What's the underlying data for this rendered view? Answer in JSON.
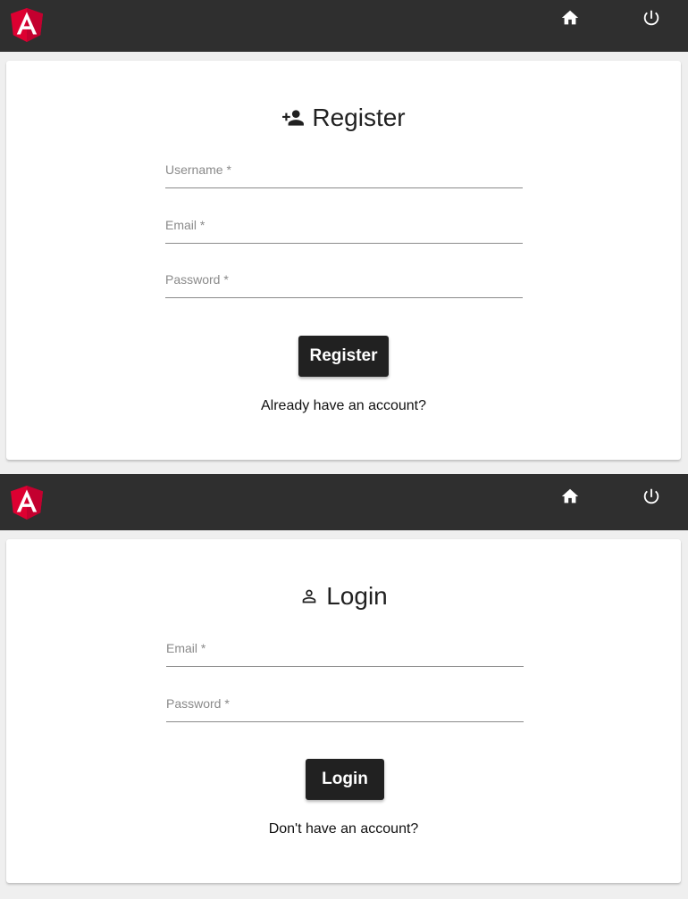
{
  "colors": {
    "toolbar": "#2f2f2f",
    "angular_red": "#dd0031",
    "button": "#212121"
  },
  "toolbar": {
    "logo_icon": "angular-logo-icon",
    "home_icon": "home-icon",
    "power_icon": "power-icon"
  },
  "register": {
    "title": "Register",
    "title_icon": "person-add-icon",
    "fields": {
      "username_placeholder": "Username *",
      "email_placeholder": "Email *",
      "password_placeholder": "Password *"
    },
    "submit_label": "Register",
    "switch_link": "Already have an account?"
  },
  "login": {
    "title": "Login",
    "title_icon": "person-outline-icon",
    "fields": {
      "email_placeholder": "Email *",
      "password_placeholder": "Password *"
    },
    "submit_label": "Login",
    "switch_link": "Don't have an account?"
  }
}
